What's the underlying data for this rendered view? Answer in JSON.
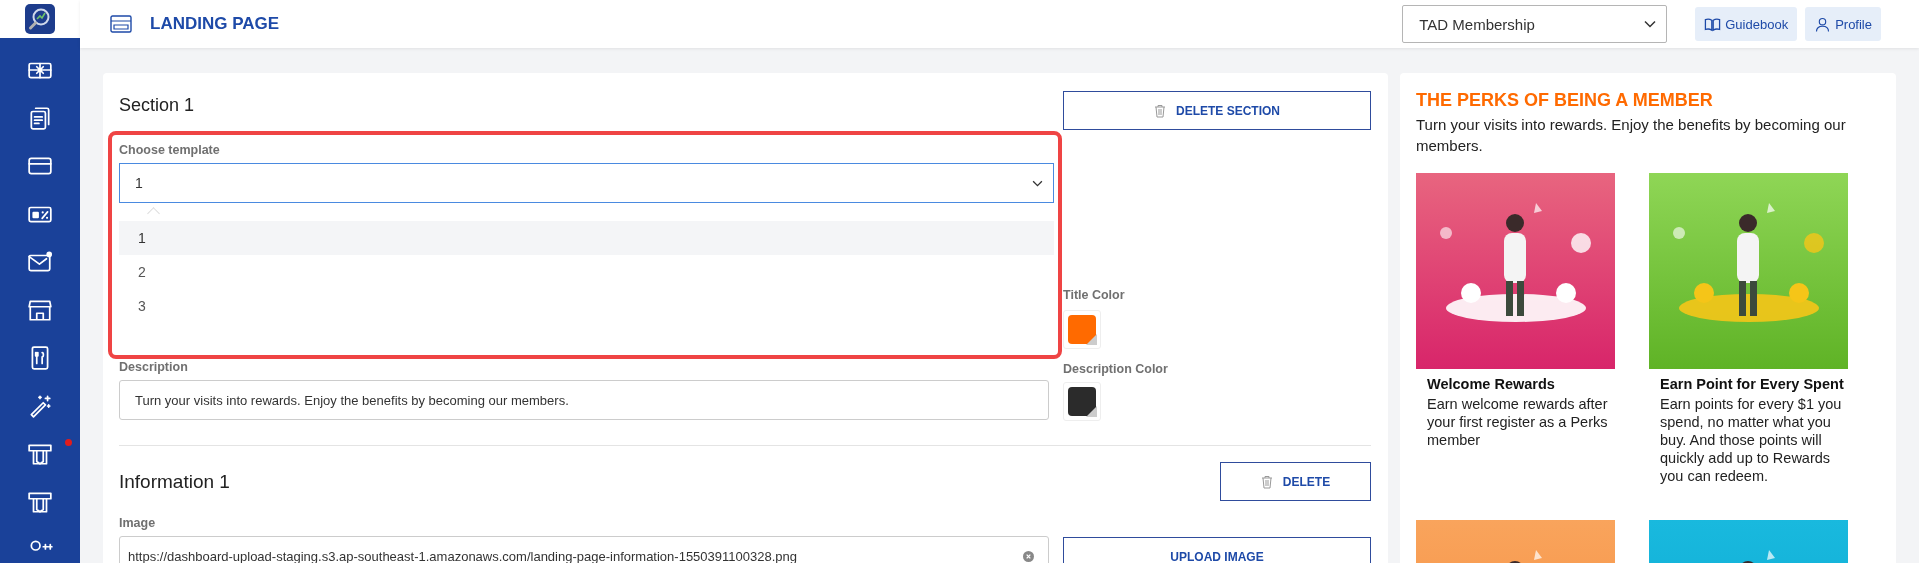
{
  "sidebar": {
    "items": [
      {
        "kind": "gift-card",
        "notification": false
      },
      {
        "kind": "documents",
        "notification": false
      },
      {
        "kind": "card",
        "notification": false
      },
      {
        "kind": "voucher",
        "notification": false
      },
      {
        "kind": "mail",
        "notification": false
      },
      {
        "kind": "store",
        "notification": false
      },
      {
        "kind": "menu",
        "notification": false
      },
      {
        "kind": "wand",
        "notification": false
      },
      {
        "kind": "dispenser",
        "notification": true
      },
      {
        "kind": "dispenser",
        "notification": false
      },
      {
        "kind": "users",
        "notification": false
      }
    ]
  },
  "header": {
    "title": "LANDING PAGE",
    "program_select": {
      "value": "TAD Membership"
    },
    "buttons": [
      {
        "kind": "book",
        "label": "Guidebook"
      },
      {
        "kind": "person",
        "label": "Profile"
      }
    ]
  },
  "section": {
    "title": "Section 1",
    "delete_button": "DELETE SECTION",
    "template": {
      "label": "Choose template",
      "value": "1",
      "expanded": true,
      "highlighted": true,
      "options": [
        {
          "label": "1",
          "selected": true
        },
        {
          "label": "2",
          "selected": false
        },
        {
          "label": "3",
          "selected": false
        }
      ]
    },
    "title_color": {
      "label": "Title Color",
      "color": "#ff6a00"
    },
    "description": {
      "label": "Description",
      "value": "Turn your visits into rewards. Enjoy the benefits by becoming our members."
    },
    "description_color": {
      "label": "Description Color",
      "color": "#2b2b2b"
    }
  },
  "information": {
    "title": "Information 1",
    "delete_button": "DELETE",
    "image": {
      "label": "Image",
      "value": "https://dashboard-upload-staging.s3.ap-southeast-1.amazonaws.com/landing-page-information-1550391100328.png"
    },
    "upload_button": "UPLOAD IMAGE"
  },
  "preview": {
    "title": "THE PERKS OF BEING A MEMBER",
    "description": "Turn your visits into rewards. Enjoy the benefits by becoming our members.",
    "cards": [
      {
        "kind": "picture",
        "title": "Welcome Rewards",
        "text": "Earn welcome rewards after your first register as a Perks member"
      },
      {
        "kind": "picture",
        "title": "Earn Point for Every Spent",
        "text": "Earn points for every $1 you spend, no matter what you buy. And those points will quickly add up to Rewards you can redeem."
      },
      {
        "kind": "picture"
      },
      {
        "kind": "picture"
      }
    ]
  }
}
